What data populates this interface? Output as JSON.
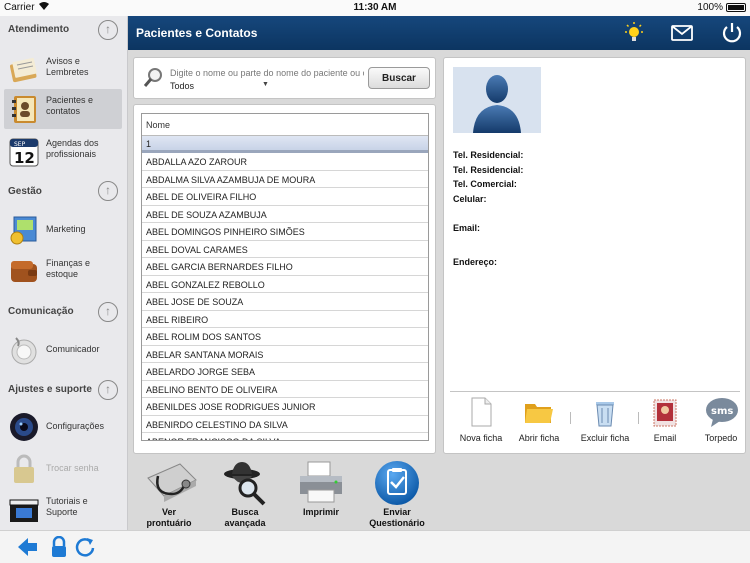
{
  "status_bar": {
    "carrier": "Carrier",
    "time": "11:30 AM",
    "battery": "100%"
  },
  "header": {
    "title": "Pacientes e Contatos",
    "icons": [
      "lightbulb-icon",
      "mail-icon",
      "power-icon"
    ]
  },
  "sidebar": {
    "sections": [
      {
        "title": "Atendimento",
        "items": [
          {
            "label": "Avisos e Lembretes",
            "icon": "notes-icon"
          },
          {
            "label": "Pacientes e contatos",
            "icon": "contacts-book-icon",
            "active": true
          },
          {
            "label": "Agendas dos profissionais",
            "icon": "calendar-icon",
            "day": "12",
            "month": "SEP"
          }
        ]
      },
      {
        "title": "Gestão",
        "items": [
          {
            "label": "Marketing",
            "icon": "marketing-icon"
          },
          {
            "label": "Finanças e estoque",
            "icon": "wallet-icon"
          }
        ]
      },
      {
        "title": "Comunicação",
        "items": [
          {
            "label": "Comunicador",
            "icon": "communicator-icon"
          }
        ]
      },
      {
        "title": "Ajustes e suporte",
        "items": [
          {
            "label": "Configurações",
            "icon": "settings-lens-icon"
          },
          {
            "label": "Trocar senha",
            "icon": "lock-icon",
            "disabled": true
          },
          {
            "label": "Tutoriais e Suporte",
            "icon": "video-icon"
          }
        ]
      }
    ]
  },
  "search": {
    "placeholder": "Digite o nome ou parte do nome do paciente ou contato",
    "filter": "Todos",
    "button": "Buscar"
  },
  "patient_list": {
    "header": "Nome",
    "rows": [
      "1",
      "ABDALLA AZO ZAROUR",
      "ABDALMA SILVA AZAMBUJA DE MOURA",
      "ABEL DE OLIVEIRA FILHO",
      "ABEL DE SOUZA AZAMBUJA",
      "ABEL DOMINGOS PINHEIRO SIMÕES",
      "ABEL DOVAL CARAMES",
      "ABEL GARCIA BERNARDES FILHO",
      "ABEL GONZALEZ REBOLLO",
      "ABEL JOSE DE SOUZA",
      "ABEL RIBEIRO",
      "ABEL ROLIM DOS SANTOS",
      "ABELAR SANTANA MORAIS",
      "ABELARDO JORGE SEBA",
      "ABELINO BENTO DE OLIVEIRA",
      "ABENILDES JOSE RODRIGUES JUNIOR",
      "ABENIRDO CELESTINO DA SILVA",
      "ABENOR FRANCISCO DA SILVA"
    ]
  },
  "details": {
    "tel_residencial_1": "Tel. Residencial:",
    "tel_residencial_2": "Tel. Residencial:",
    "tel_comercial": "Tel. Comercial:",
    "celular": "Celular:",
    "email": "Email:",
    "endereco": "Endereço:"
  },
  "actions": [
    {
      "label": "Nova ficha",
      "icon": "document-icon"
    },
    {
      "label": "Abrir ficha",
      "icon": "folder-icon"
    },
    {
      "label": "Excluir ficha",
      "icon": "trash-icon"
    },
    {
      "label": "Email",
      "icon": "stamp-icon"
    },
    {
      "label": "Torpedo",
      "icon": "sms-icon",
      "badge": "sms"
    }
  ],
  "tools": [
    {
      "label_1": "Ver",
      "label_2": "prontuário",
      "icon": "stethoscope-icon"
    },
    {
      "label_1": "Busca",
      "label_2": "avançada",
      "icon": "detective-icon"
    },
    {
      "label_1": "Imprimir",
      "label_2": "",
      "icon": "printer-icon"
    },
    {
      "label_1": "Enviar",
      "label_2": "Questionário",
      "icon": "clipboard-check-icon"
    }
  ],
  "bottom_bar": {
    "icons": [
      "back-arrow-icon",
      "lock-icon",
      "refresh-icon"
    ]
  },
  "colors": {
    "header": "#0c3561",
    "accent": "#1e7ad4",
    "selected_row": "#c8d3e7"
  }
}
